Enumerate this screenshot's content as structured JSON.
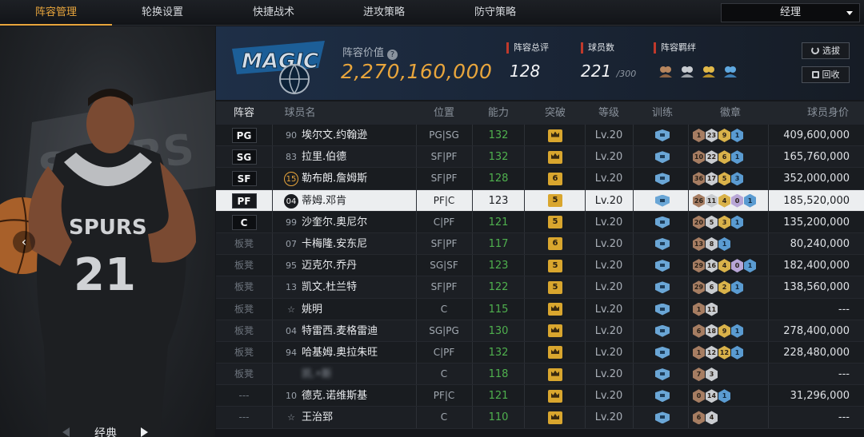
{
  "tabs": [
    "阵容管理",
    "轮换设置",
    "快捷战术",
    "进攻策略",
    "防守策略"
  ],
  "dropdown": {
    "selected": "经理"
  },
  "left_panel": {
    "style_label": "经典",
    "jersey_number": "21",
    "team_word": "SPURS"
  },
  "header": {
    "team_logo_text": "MAGIC",
    "value_label": "阵容价值",
    "value": "2,270,160,000",
    "rating_label": "阵容总评",
    "rating": "128",
    "count_label": "球员数",
    "count": "221",
    "count_max": "/300",
    "fetters_label": "阵容羁绊",
    "buttons": {
      "select": "选拔",
      "recycle": "回收"
    }
  },
  "table": {
    "headers": [
      "阵容",
      "球员名",
      "位置",
      "能力",
      "突破",
      "等级",
      "训练",
      "徽章",
      "球员身价"
    ],
    "rows": [
      {
        "role": "PG",
        "starter": true,
        "num": "90",
        "num_style": "plain",
        "name": "埃尔文.约翰逊",
        "pos": "PG|SG",
        "ability": "132",
        "break": "crown",
        "level": "Lv.20",
        "badges": [
          [
            "bronze",
            "1"
          ],
          [
            "silver",
            "23"
          ],
          [
            "gold",
            "9"
          ],
          [
            "blue",
            "1"
          ]
        ],
        "value": "409,600,000"
      },
      {
        "role": "SG",
        "starter": true,
        "num": "83",
        "num_style": "plain",
        "name": "拉里.伯德",
        "pos": "SF|PF",
        "ability": "132",
        "break": "crown",
        "level": "Lv.20",
        "badges": [
          [
            "bronze",
            "10"
          ],
          [
            "silver",
            "22"
          ],
          [
            "gold",
            "6"
          ],
          [
            "blue",
            "1"
          ]
        ],
        "value": "165,760,000"
      },
      {
        "role": "SF",
        "starter": true,
        "num": "15",
        "num_style": "gold",
        "name": "勒布朗.詹姆斯",
        "pos": "SF|PF",
        "ability": "128",
        "break": "6",
        "level": "Lv.20",
        "badges": [
          [
            "bronze",
            "36"
          ],
          [
            "silver",
            "17"
          ],
          [
            "gold",
            "5"
          ],
          [
            "blue",
            "3"
          ]
        ],
        "value": "352,000,000"
      },
      {
        "role": "PF",
        "starter": true,
        "selected": true,
        "num": "04",
        "num_style": "dark",
        "name": "蒂姆.邓肯",
        "pos": "PF|C",
        "ability": "123",
        "break": "5",
        "level": "Lv.20",
        "badges": [
          [
            "bronze",
            "26"
          ],
          [
            "silver",
            "11"
          ],
          [
            "gold",
            "4"
          ],
          [
            "purple",
            "0"
          ],
          [
            "blue",
            "1"
          ]
        ],
        "value": "185,520,000"
      },
      {
        "role": "C",
        "starter": true,
        "num": "99",
        "num_style": "plain",
        "name": "沙奎尔.奥尼尔",
        "pos": "C|PF",
        "ability": "121",
        "break": "5",
        "level": "Lv.20",
        "badges": [
          [
            "bronze",
            "20"
          ],
          [
            "silver",
            "5"
          ],
          [
            "gold",
            "3"
          ],
          [
            "blue",
            "1"
          ]
        ],
        "value": "135,200,000"
      },
      {
        "role": "板凳",
        "starter": false,
        "num": "07",
        "num_style": "plain",
        "name": "卡梅隆.安东尼",
        "pos": "SF|PF",
        "ability": "117",
        "break": "6",
        "level": "Lv.20",
        "badges": [
          [
            "bronze",
            "13"
          ],
          [
            "silver",
            "8"
          ],
          [
            "blue",
            "1"
          ]
        ],
        "value": "80,240,000"
      },
      {
        "role": "板凳",
        "starter": false,
        "num": "95",
        "num_style": "plain",
        "name": "迈克尔.乔丹",
        "pos": "SG|SF",
        "ability": "123",
        "break": "5",
        "level": "Lv.20",
        "badges": [
          [
            "bronze",
            "29"
          ],
          [
            "silver",
            "16"
          ],
          [
            "gold",
            "4"
          ],
          [
            "purple",
            "0"
          ],
          [
            "blue",
            "1"
          ]
        ],
        "value": "182,400,000"
      },
      {
        "role": "板凳",
        "starter": false,
        "num": "13",
        "num_style": "plain",
        "name": "凯文.杜兰特",
        "pos": "SF|PF",
        "ability": "122",
        "break": "5",
        "level": "Lv.20",
        "badges": [
          [
            "bronze",
            "29"
          ],
          [
            "silver",
            "6"
          ],
          [
            "gold",
            "2"
          ],
          [
            "blue",
            "1"
          ]
        ],
        "value": "138,560,000"
      },
      {
        "role": "板凳",
        "starter": false,
        "num": "☆",
        "num_style": "plain",
        "name": "姚明",
        "pos": "C",
        "ability": "115",
        "break": "crown",
        "level": "Lv.20",
        "badges": [
          [
            "bronze",
            "1"
          ],
          [
            "silver",
            "11"
          ]
        ],
        "value": "---"
      },
      {
        "role": "板凳",
        "starter": false,
        "num": "04",
        "num_style": "plain",
        "name": "特雷西.麦格雷迪",
        "pos": "SG|PG",
        "ability": "130",
        "break": "crown",
        "level": "Lv.20",
        "badges": [
          [
            "bronze",
            "6"
          ],
          [
            "silver",
            "18"
          ],
          [
            "gold",
            "9"
          ],
          [
            "blue",
            "1"
          ]
        ],
        "value": "278,400,000"
      },
      {
        "role": "板凳",
        "starter": false,
        "num": "94",
        "num_style": "plain",
        "name": "哈基姆.奥拉朱旺",
        "pos": "C|PF",
        "ability": "132",
        "break": "crown",
        "level": "Lv.20",
        "badges": [
          [
            "bronze",
            "1"
          ],
          [
            "silver",
            "12"
          ],
          [
            "gold",
            "12"
          ],
          [
            "blue",
            "1"
          ]
        ],
        "value": "228,480,000"
      },
      {
        "role": "板凳",
        "starter": false,
        "num": "",
        "num_style": "plain",
        "name": "凯.•斯",
        "blurred": true,
        "pos": "C",
        "ability": "118",
        "break": "crown",
        "level": "Lv.20",
        "badges": [
          [
            "bronze",
            "7"
          ],
          [
            "silver",
            "3"
          ]
        ],
        "value": "---"
      },
      {
        "role": "---",
        "starter": false,
        "num": "10",
        "num_style": "plain",
        "name": "德克.诺维斯基",
        "pos": "PF|C",
        "ability": "121",
        "break": "crown",
        "level": "Lv.20",
        "badges": [
          [
            "bronze",
            "0"
          ],
          [
            "silver",
            "14"
          ],
          [
            "blue",
            "1"
          ]
        ],
        "value": "31,296,000"
      },
      {
        "role": "---",
        "starter": false,
        "num": "☆",
        "num_style": "plain",
        "name": "王治郅",
        "pos": "C",
        "ability": "110",
        "break": "crown",
        "level": "Lv.20",
        "badges": [
          [
            "bronze",
            "6"
          ],
          [
            "silver",
            "4"
          ]
        ],
        "value": "---"
      }
    ]
  }
}
